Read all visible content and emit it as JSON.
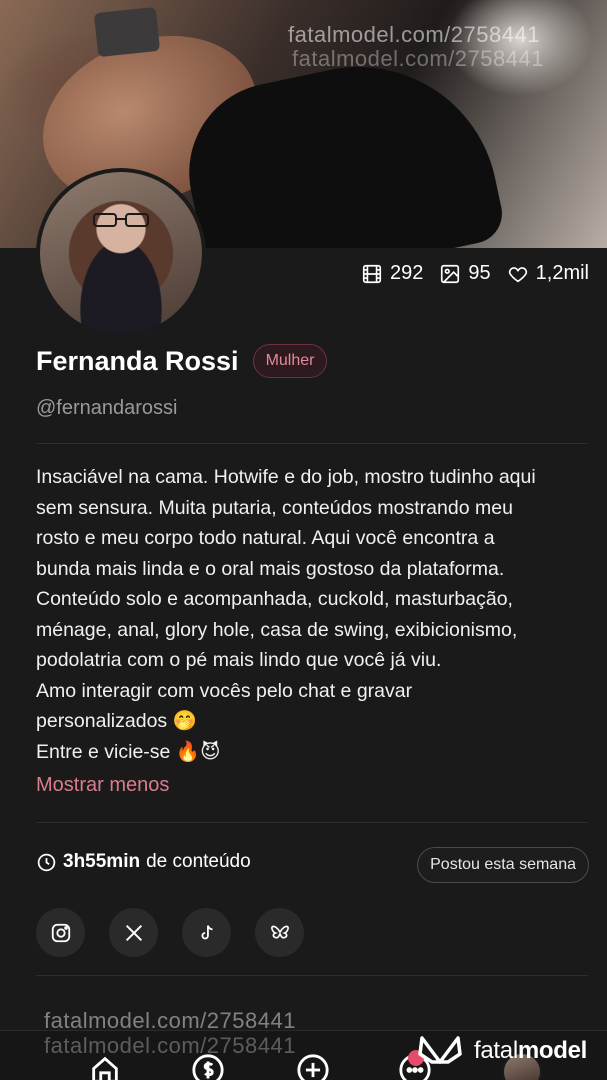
{
  "cover": {
    "watermark_1": "fatalmodel.com/2758441",
    "watermark_2": "fatalmodel.com/2758441"
  },
  "stats": {
    "videos": "292",
    "photos": "95",
    "likes": "1,2mil",
    "icons": [
      "video-icon",
      "photo-icon",
      "heart-icon"
    ]
  },
  "profile": {
    "name": "Fernanda Rossi",
    "gender_badge": "Mulher",
    "handle": "@fernandarossi"
  },
  "bio": {
    "lines": [
      "Insaciável na cama. Hotwife e do job, mostro tudinho aqui",
      "sem sensura. Muita putaria, conteúdos mostrando meu",
      "rosto e meu corpo todo natural. Aqui você encontra a",
      "bunda mais linda e o oral mais gostoso da plataforma.",
      "Conteúdo solo e acompanhada, cuckold, masturbação,",
      "ménage, anal, glory hole, casa de swing, exibicionismo,",
      "podolatria com o pé mais lindo que você já viu.",
      "Amo interagir com vocês pelo chat e gravar",
      "personalizados 🤭",
      "Entre e vicie-se 🔥😈"
    ],
    "toggle_label": "Mostrar menos"
  },
  "content": {
    "duration": "3h55min",
    "suffix": "de conteúdo",
    "posted_label": "Postou esta semana"
  },
  "socials": [
    "instagram-icon",
    "x-icon",
    "tiktok-icon",
    "bluesky-icon"
  ],
  "footer": {
    "watermark_1": "fatalmodel.com/2758441",
    "watermark_2": "fatalmodel.com/2758441",
    "brand_light": "fatal",
    "brand_bold": "model"
  },
  "colors": {
    "background": "#1a1a1a",
    "accent_pink": "#d97c8c",
    "badge_bg": "#2c1a1e"
  }
}
